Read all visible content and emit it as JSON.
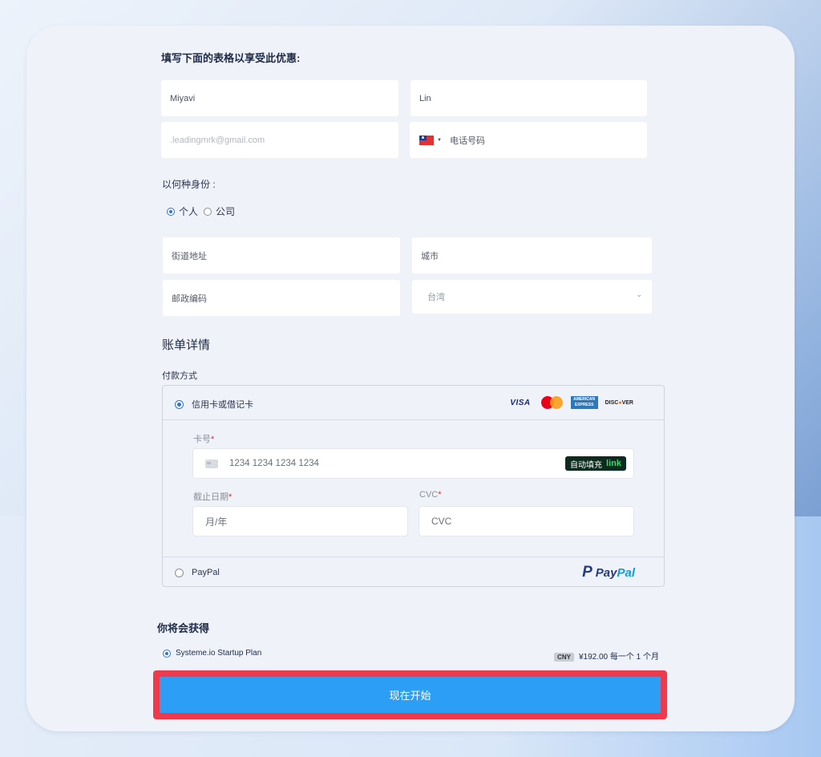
{
  "form": {
    "intro": "填写下面的表格以享受此优惠:",
    "first_name_value": "Miyavi",
    "last_name_value": "Lin",
    "email_value": ".leadingmrk@gmail.com",
    "phone_placeholder": "电话号码",
    "identity_label": "以何种身份 :",
    "identity_options": [
      "个人",
      "公司"
    ],
    "street_placeholder": "街道地址",
    "city_placeholder": "城市",
    "postal_placeholder": "邮政编码",
    "country_value": "台湾"
  },
  "billing": {
    "title": "账单详情",
    "payment_method_label": "付款方式",
    "card_option": "信用卡或借记卡",
    "card_brands": [
      "VISA",
      "MasterCard",
      "AMERICAN EXPRESS",
      "DISCOVER"
    ],
    "card_number_label": "卡号",
    "card_number_placeholder": "1234 1234 1234 1234",
    "autofill_label": "自动填充",
    "autofill_brand": "link",
    "expiry_label": "截止日期",
    "expiry_placeholder": "月/年",
    "cvc_label": "CVC",
    "cvc_placeholder": "CVC",
    "paypal_option": "PayPal",
    "paypal_logo_pay": "Pay",
    "paypal_logo_pal": "Pal",
    "required_mark": "*"
  },
  "summary": {
    "title": "你将会获得",
    "plan_name": "Systeme.io Startup Plan",
    "currency_badge": "CNY",
    "price": "¥192.00 每一个 1 个月"
  },
  "cta": {
    "label": "现在开始"
  },
  "colors": {
    "accent": "#2d9ef5",
    "highlight": "#ef3a4b",
    "radio": "#2d74d9"
  }
}
